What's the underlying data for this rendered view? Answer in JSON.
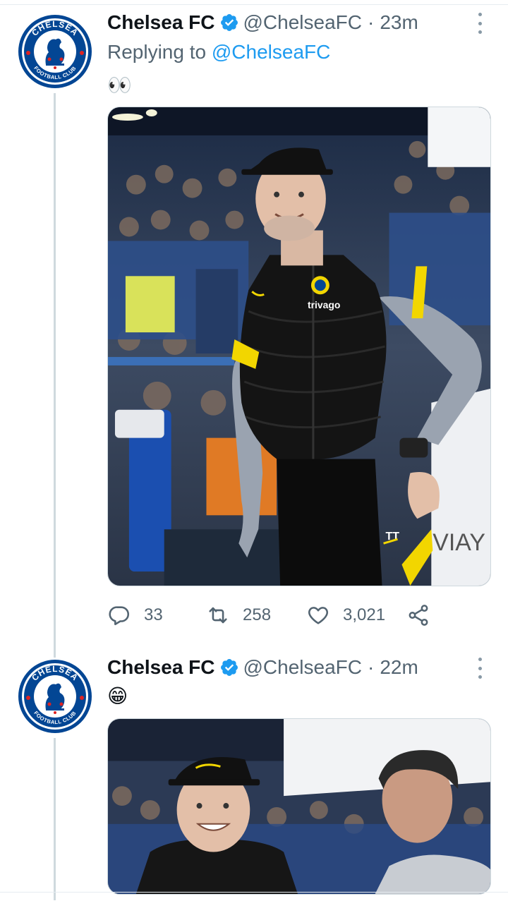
{
  "tweets": [
    {
      "author": "Chelsea FC",
      "handle": "@ChelseaFC",
      "time": "23m",
      "replying_prefix": "Replying to",
      "replying_handle": "@ChelseaFC",
      "text": "👀",
      "stats": {
        "replies": "33",
        "retweets": "258",
        "likes": "3,021"
      }
    },
    {
      "author": "Chelsea FC",
      "handle": "@ChelseaFC",
      "time": "22m",
      "text": "😁"
    }
  ],
  "separator": "·",
  "avatar": {
    "text_top": "CHELSEA",
    "text_bottom": "FOOTBALL CLUB"
  },
  "photo1": {
    "sponsor": "trivago",
    "initials": "TT",
    "signage": "VIAY"
  },
  "colors": {
    "accent": "#1d9bf0",
    "chelsea_blue": "#034694",
    "kit_yellow": "#f2d600"
  },
  "icons": [
    "verified-badge-icon",
    "more-icon",
    "reply-icon",
    "retweet-icon",
    "like-icon",
    "share-icon"
  ]
}
